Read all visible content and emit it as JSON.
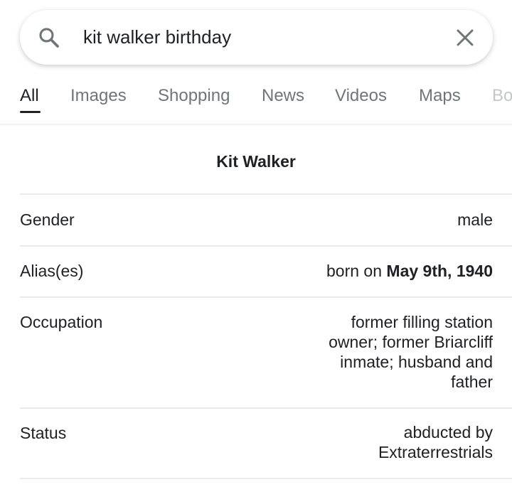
{
  "search": {
    "query": "kit walker birthday"
  },
  "tabs": [
    {
      "label": "All"
    },
    {
      "label": "Images"
    },
    {
      "label": "Shopping"
    },
    {
      "label": "News"
    },
    {
      "label": "Videos"
    },
    {
      "label": "Maps"
    },
    {
      "label": "Bo"
    }
  ],
  "knowledge_table": {
    "title": "Kit Walker",
    "rows": [
      {
        "label": "Gender",
        "value": "male"
      },
      {
        "label": "Alias(es)",
        "value_prefix": "born on ",
        "value_bold": "May 9th, 1940"
      },
      {
        "label": "Occupation",
        "value_lines": [
          "former filling station",
          "owner; former Briarcliff",
          "inmate; husband and",
          "father"
        ]
      },
      {
        "label": "Status",
        "value_lines": [
          "abducted by",
          "Extraterrestrials"
        ]
      }
    ]
  },
  "colors": {
    "text": "#202124",
    "tab_inactive": "#70757a",
    "icon": "#70757a",
    "divider": "#e8eaed"
  },
  "icons": {
    "search": "search-icon",
    "clear": "close-icon"
  }
}
